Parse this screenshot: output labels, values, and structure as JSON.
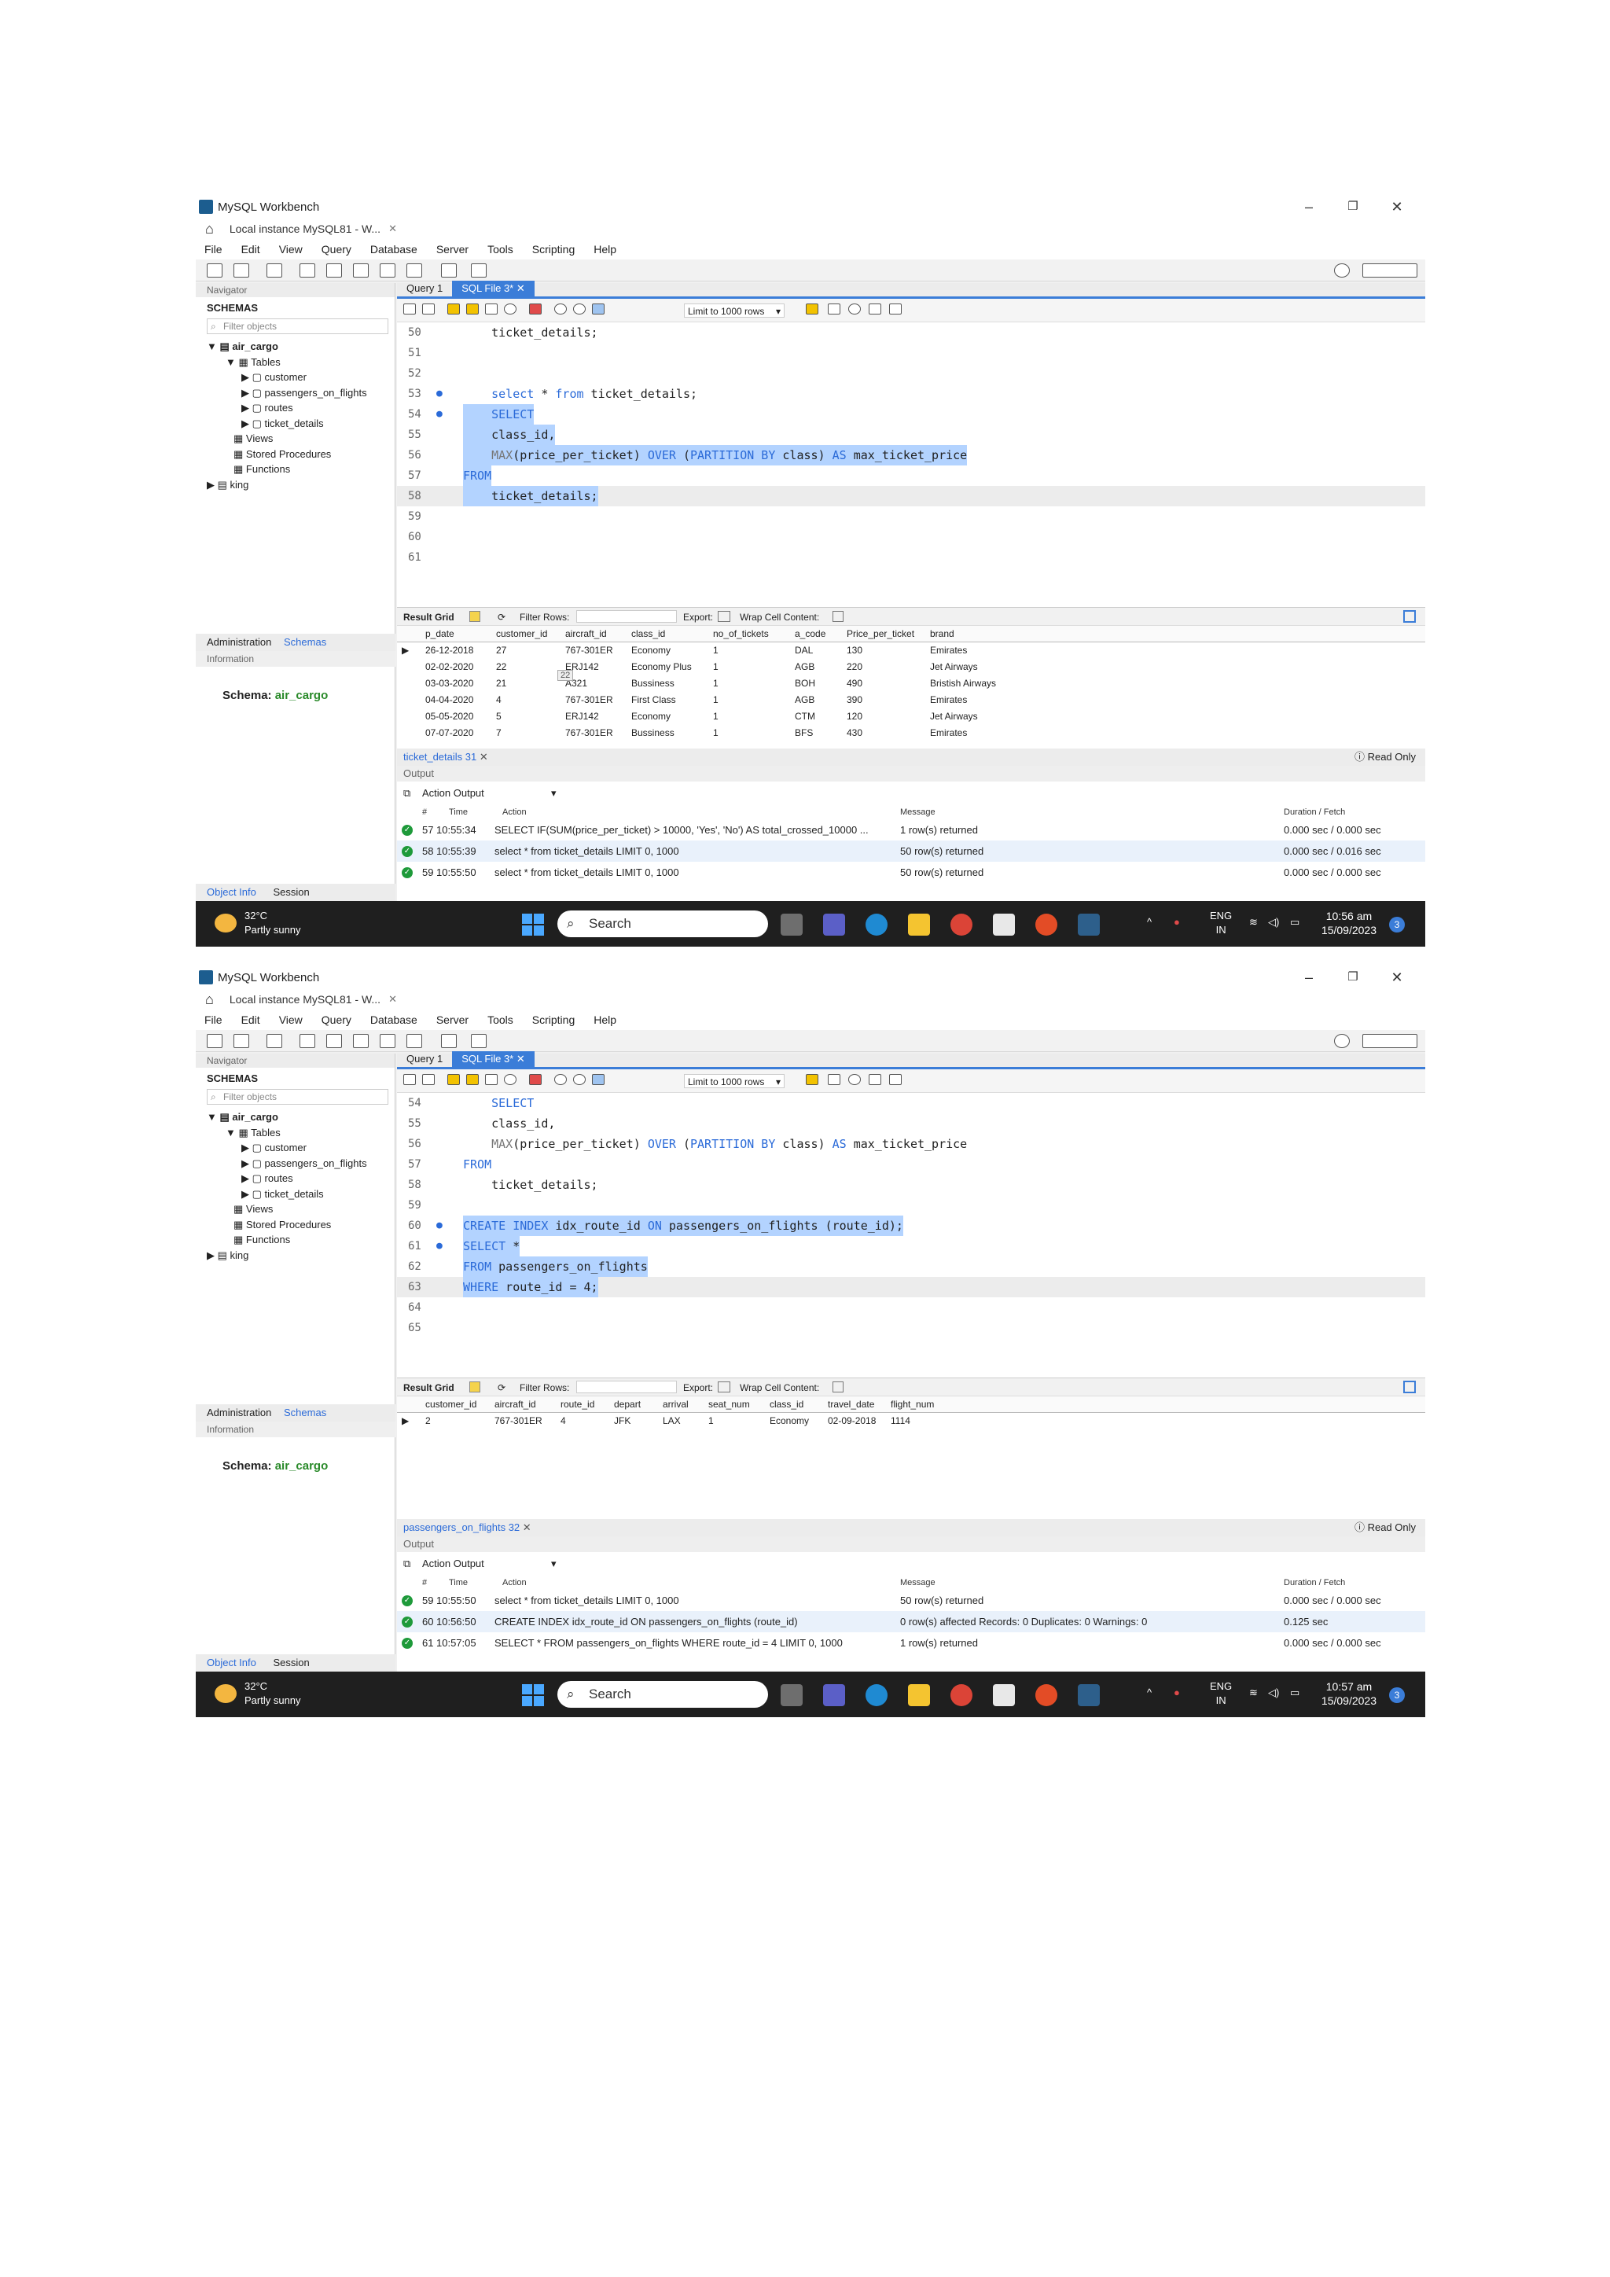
{
  "shot1": {
    "window_title": "MySQL Workbench",
    "connection_tab": "Local instance MySQL81 - W...",
    "menu": [
      "File",
      "Edit",
      "View",
      "Query",
      "Database",
      "Server",
      "Tools",
      "Scripting",
      "Help"
    ],
    "navigator_label": "Navigator",
    "schemas_label": "SCHEMAS",
    "filter_placeholder": "Filter objects",
    "tree": [
      "air_cargo",
      "Tables",
      "customer",
      "passengers_on_flights",
      "routes",
      "ticket_details",
      "Views",
      "Stored Procedures",
      "Functions",
      "king"
    ],
    "admin_tab": "Administration",
    "schemas_tab": "Schemas",
    "information_label": "Information",
    "schema_label": "Schema:",
    "schema_value": "air_cargo",
    "object_info_tab": "Object Info",
    "session_tab": "Session",
    "query_tabs": [
      "Query 1",
      "SQL File 3*"
    ],
    "limit_rows": "Limit to 1000 rows",
    "code_lines": [
      {
        "n": "50",
        "dot": "",
        "text": "    ticket_details;"
      },
      {
        "n": "51",
        "dot": "",
        "text": ""
      },
      {
        "n": "52",
        "dot": "",
        "text": ""
      },
      {
        "n": "53",
        "dot": "●",
        "text": "    select * from ticket_details;"
      },
      {
        "n": "54",
        "dot": "●",
        "text": "    SELECT"
      },
      {
        "n": "55",
        "dot": "",
        "text": "    class_id,"
      },
      {
        "n": "56",
        "dot": "",
        "text": "    MAX(price_per_ticket) OVER (PARTITION BY class) AS max_ticket_price"
      },
      {
        "n": "57",
        "dot": "",
        "text": "FROM"
      },
      {
        "n": "58",
        "dot": "",
        "text": "    ticket_details;"
      },
      {
        "n": "59",
        "dot": "",
        "text": ""
      },
      {
        "n": "60",
        "dot": "",
        "text": ""
      },
      {
        "n": "61",
        "dot": "",
        "text": ""
      }
    ],
    "result_grid_label": "Result Grid",
    "filter_rows_label": "Filter Rows:",
    "export_label": "Export:",
    "wrap_label": "Wrap Cell Content:",
    "grid_columns": [
      "p_date",
      "customer_id",
      "aircraft_id",
      "class_id",
      "no_of_tickets",
      "a_code",
      "Price_per_ticket",
      "brand"
    ],
    "grid_rows": [
      [
        "26-12-2018",
        "27",
        "767-301ER",
        "Economy",
        "1",
        "DAL",
        "130",
        "Emirates"
      ],
      [
        "02-02-2020",
        "22",
        "ERJ142",
        "Economy Plus",
        "1",
        "AGB",
        "220",
        "Jet Airways"
      ],
      [
        "03-03-2020",
        "21",
        "A321",
        "Bussiness",
        "1",
        "BOH",
        "490",
        "Bristish Airways"
      ],
      [
        "04-04-2020",
        "4",
        "767-301ER",
        "First Class",
        "1",
        "AGB",
        "390",
        "Emirates"
      ],
      [
        "05-05-2020",
        "5",
        "ERJ142",
        "Economy",
        "1",
        "CTM",
        "120",
        "Jet Airways"
      ],
      [
        "07-07-2020",
        "7",
        "767-301ER",
        "Bussiness",
        "1",
        "BFS",
        "430",
        "Emirates"
      ]
    ],
    "cell_tooltip": "22",
    "result_tab": "ticket_details 31",
    "read_only": "Read Only",
    "output_label": "Output",
    "action_output": "Action Output",
    "out_cols": {
      "hash": "#",
      "time": "Time",
      "action": "Action",
      "message": "Message",
      "duration": "Duration / Fetch"
    },
    "out_rows": [
      {
        "n": "57",
        "time": "10:55:34",
        "action": "SELECT    IF(SUM(price_per_ticket) > 10000, 'Yes', 'No') AS total_crossed_10000 ...",
        "message": "1 row(s) returned",
        "duration": "0.000 sec / 0.000 sec"
      },
      {
        "n": "58",
        "time": "10:55:39",
        "action": "select * from ticket_details LIMIT 0, 1000",
        "message": "50 row(s) returned",
        "duration": "0.000 sec / 0.016 sec"
      },
      {
        "n": "59",
        "time": "10:55:50",
        "action": "select * from ticket_details LIMIT 0, 1000",
        "message": "50 row(s) returned",
        "duration": "0.000 sec / 0.000 sec"
      }
    ],
    "weather_temp": "32°C",
    "weather_desc": "Partly sunny",
    "search_label": "Search",
    "lang": "ENG",
    "region": "IN",
    "time": "10:56 am",
    "date": "15/09/2023",
    "notif_count": "3"
  },
  "shot2": {
    "window_title": "MySQL Workbench",
    "connection_tab": "Local instance MySQL81 - W...",
    "menu": [
      "File",
      "Edit",
      "View",
      "Query",
      "Database",
      "Server",
      "Tools",
      "Scripting",
      "Help"
    ],
    "navigator_label": "Navigator",
    "schemas_label": "SCHEMAS",
    "filter_placeholder": "Filter objects",
    "tree": [
      "air_cargo",
      "Tables",
      "customer",
      "passengers_on_flights",
      "routes",
      "ticket_details",
      "Views",
      "Stored Procedures",
      "Functions",
      "king"
    ],
    "admin_tab": "Administration",
    "schemas_tab": "Schemas",
    "information_label": "Information",
    "schema_label": "Schema:",
    "schema_value": "air_cargo",
    "object_info_tab": "Object Info",
    "session_tab": "Session",
    "query_tabs": [
      "Query 1",
      "SQL File 3*"
    ],
    "limit_rows": "Limit to 1000 rows",
    "code_lines": [
      {
        "n": "54",
        "dot": "",
        "text": "    SELECT"
      },
      {
        "n": "55",
        "dot": "",
        "text": "    class_id,"
      },
      {
        "n": "56",
        "dot": "",
        "text": "    MAX(price_per_ticket) OVER (PARTITION BY class) AS max_ticket_price"
      },
      {
        "n": "57",
        "dot": "",
        "text": "FROM"
      },
      {
        "n": "58",
        "dot": "",
        "text": "    ticket_details;"
      },
      {
        "n": "59",
        "dot": "",
        "text": ""
      },
      {
        "n": "60",
        "dot": "●",
        "text": "CREATE INDEX idx_route_id ON passengers_on_flights (route_id);"
      },
      {
        "n": "61",
        "dot": "●",
        "text": "SELECT *"
      },
      {
        "n": "62",
        "dot": "",
        "text": "FROM passengers_on_flights"
      },
      {
        "n": "63",
        "dot": "",
        "text": "WHERE route_id = 4;"
      },
      {
        "n": "64",
        "dot": "",
        "text": ""
      },
      {
        "n": "65",
        "dot": "",
        "text": ""
      }
    ],
    "result_grid_label": "Result Grid",
    "filter_rows_label": "Filter Rows:",
    "export_label": "Export:",
    "wrap_label": "Wrap Cell Content:",
    "grid_columns": [
      "customer_id",
      "aircraft_id",
      "route_id",
      "depart",
      "arrival",
      "seat_num",
      "class_id",
      "travel_date",
      "flight_num"
    ],
    "grid_rows": [
      [
        "2",
        "767-301ER",
        "4",
        "JFK",
        "LAX",
        "1",
        "Economy",
        "02-09-2018",
        "1114"
      ]
    ],
    "result_tab": "passengers_on_flights 32",
    "read_only": "Read Only",
    "output_label": "Output",
    "action_output": "Action Output",
    "out_cols": {
      "hash": "#",
      "time": "Time",
      "action": "Action",
      "message": "Message",
      "duration": "Duration / Fetch"
    },
    "out_rows": [
      {
        "n": "59",
        "time": "10:55:50",
        "action": "select * from ticket_details LIMIT 0, 1000",
        "message": "50 row(s) returned",
        "duration": "0.000 sec / 0.000 sec"
      },
      {
        "n": "60",
        "time": "10:56:50",
        "action": "CREATE INDEX idx_route_id ON passengers_on_flights (route_id)",
        "message": "0 row(s) affected Records: 0  Duplicates: 0  Warnings: 0",
        "duration": "0.125 sec"
      },
      {
        "n": "61",
        "time": "10:57:05",
        "action": "SELECT * FROM passengers_on_flights WHERE route_id = 4 LIMIT 0, 1000",
        "message": "1 row(s) returned",
        "duration": "0.000 sec / 0.000 sec"
      }
    ],
    "weather_temp": "32°C",
    "weather_desc": "Partly sunny",
    "search_label": "Search",
    "lang": "ENG",
    "region": "IN",
    "time": "10:57 am",
    "date": "15/09/2023",
    "notif_count": "3"
  }
}
